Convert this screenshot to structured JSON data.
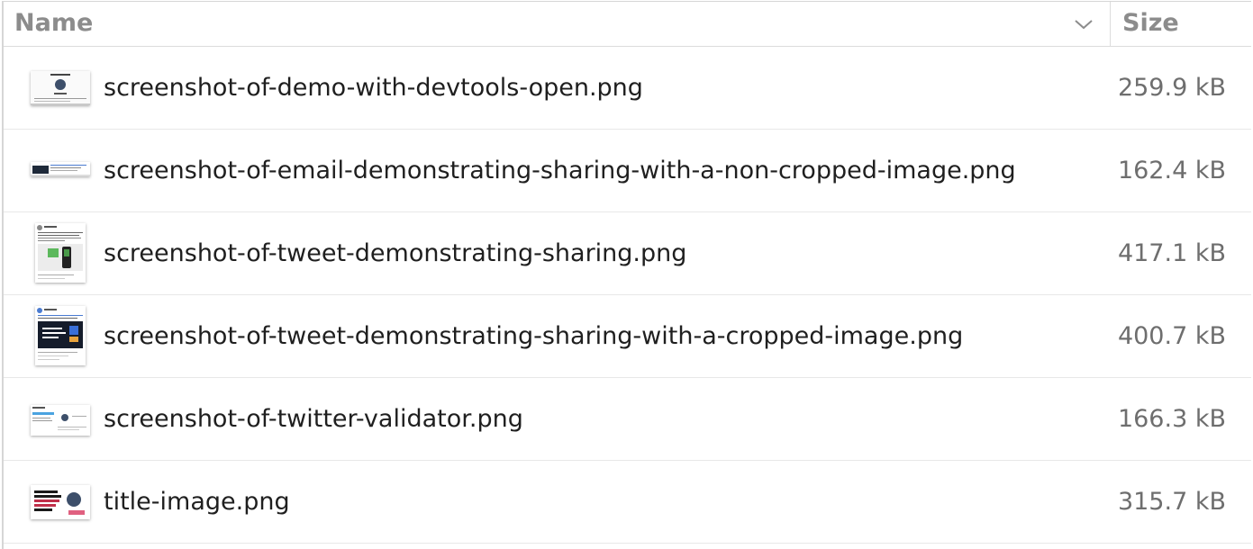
{
  "columns": {
    "name_label": "Name",
    "size_label": "Size",
    "sort_icon": "chevron-down-icon"
  },
  "files": [
    {
      "name": "screenshot-of-demo-with-devtools-open.png",
      "size": "259.9 kB"
    },
    {
      "name": "screenshot-of-email-demonstrating-sharing-with-a-non-cropped-image.png",
      "size": "162.4 kB"
    },
    {
      "name": "screenshot-of-tweet-demonstrating-sharing.png",
      "size": "417.1 kB"
    },
    {
      "name": "screenshot-of-tweet-demonstrating-sharing-with-a-cropped-image.png",
      "size": "400.7 kB"
    },
    {
      "name": "screenshot-of-twitter-validator.png",
      "size": "166.3 kB"
    },
    {
      "name": "title-image.png",
      "size": "315.7 kB"
    }
  ],
  "colors": {
    "header_text": "#8c8c8c",
    "name_text": "#1f1f1f",
    "size_text": "#6e6e6e",
    "divider": "#dcdcdc"
  }
}
